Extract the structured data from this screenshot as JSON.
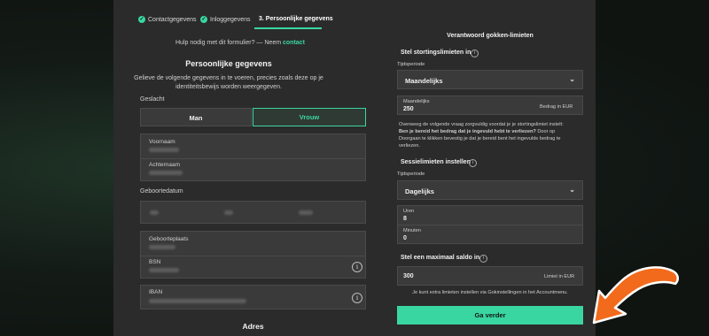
{
  "steps": [
    {
      "label": "Contactgegevens",
      "done": true
    },
    {
      "label": "Inloggegevens",
      "done": true
    },
    {
      "label": "3. Persoonlijke gegevens",
      "done": false
    }
  ],
  "help": {
    "text": "Hulp nodig met dit formulier? — Neem",
    "link": "contact"
  },
  "personal": {
    "title": "Persoonlijke gegevens",
    "description_line1": "Gelieve de volgende gegevens in te voeren, precies zoals deze op je",
    "description_line2": "identiteitsbewijs worden weergegeven.",
    "gender_label": "Geslacht",
    "gender_options": [
      "Man",
      "Vrouw"
    ],
    "gender_selected": "Vrouw",
    "first_name_label": "Voornaam",
    "last_name_label": "Achternaam",
    "dob_label": "Geboortedatum",
    "birthplace_label": "Geboorteplaats",
    "bsn_label": "BSN",
    "iban_label": "IBAN",
    "address_title": "Adres"
  },
  "limits": {
    "title": "Verantwoord gokken-limieten",
    "deposit_title": "Stel stortingslimieten in",
    "period_label": "Tijdsperiode",
    "deposit_period": "Maandelijks",
    "amount_label": "Maandelijks",
    "amount_value": "250",
    "amount_unit": "Bedrag in EUR",
    "notice_line1": "Overweeg de volgende vraag zorgvuldig voordat je je stortingslimiet instelt:",
    "notice_bold": "Ben je bereid het bedrag dat je ingevuld hebt te verliezen?",
    "notice_line2": "Door op",
    "notice_line3": "Doorgaan te klikken bevestig je dat je bereid bent het ingevulde bedrag te",
    "notice_line4": "verliezen.",
    "session_title": "Sessielimieten instellen",
    "session_period_label": "Tijdsperiode",
    "session_period": "Dagelijks",
    "hours_label": "Uren",
    "hours_value": "8",
    "minutes_label": "Minuten",
    "minutes_value": "0",
    "balance_title": "Stel een maximaal saldo in",
    "balance_value": "300",
    "balance_unit": "Limiet in EUR",
    "footer_note": "Je kunt extra limieten instellen via Gokinstellingen in het Accountmenu.",
    "continue_button": "Ga verder"
  },
  "colors": {
    "accent": "#3ad6a2",
    "arrow": "#f26a1b",
    "panel": "#2b2b2b",
    "field": "#3a3a3a"
  }
}
